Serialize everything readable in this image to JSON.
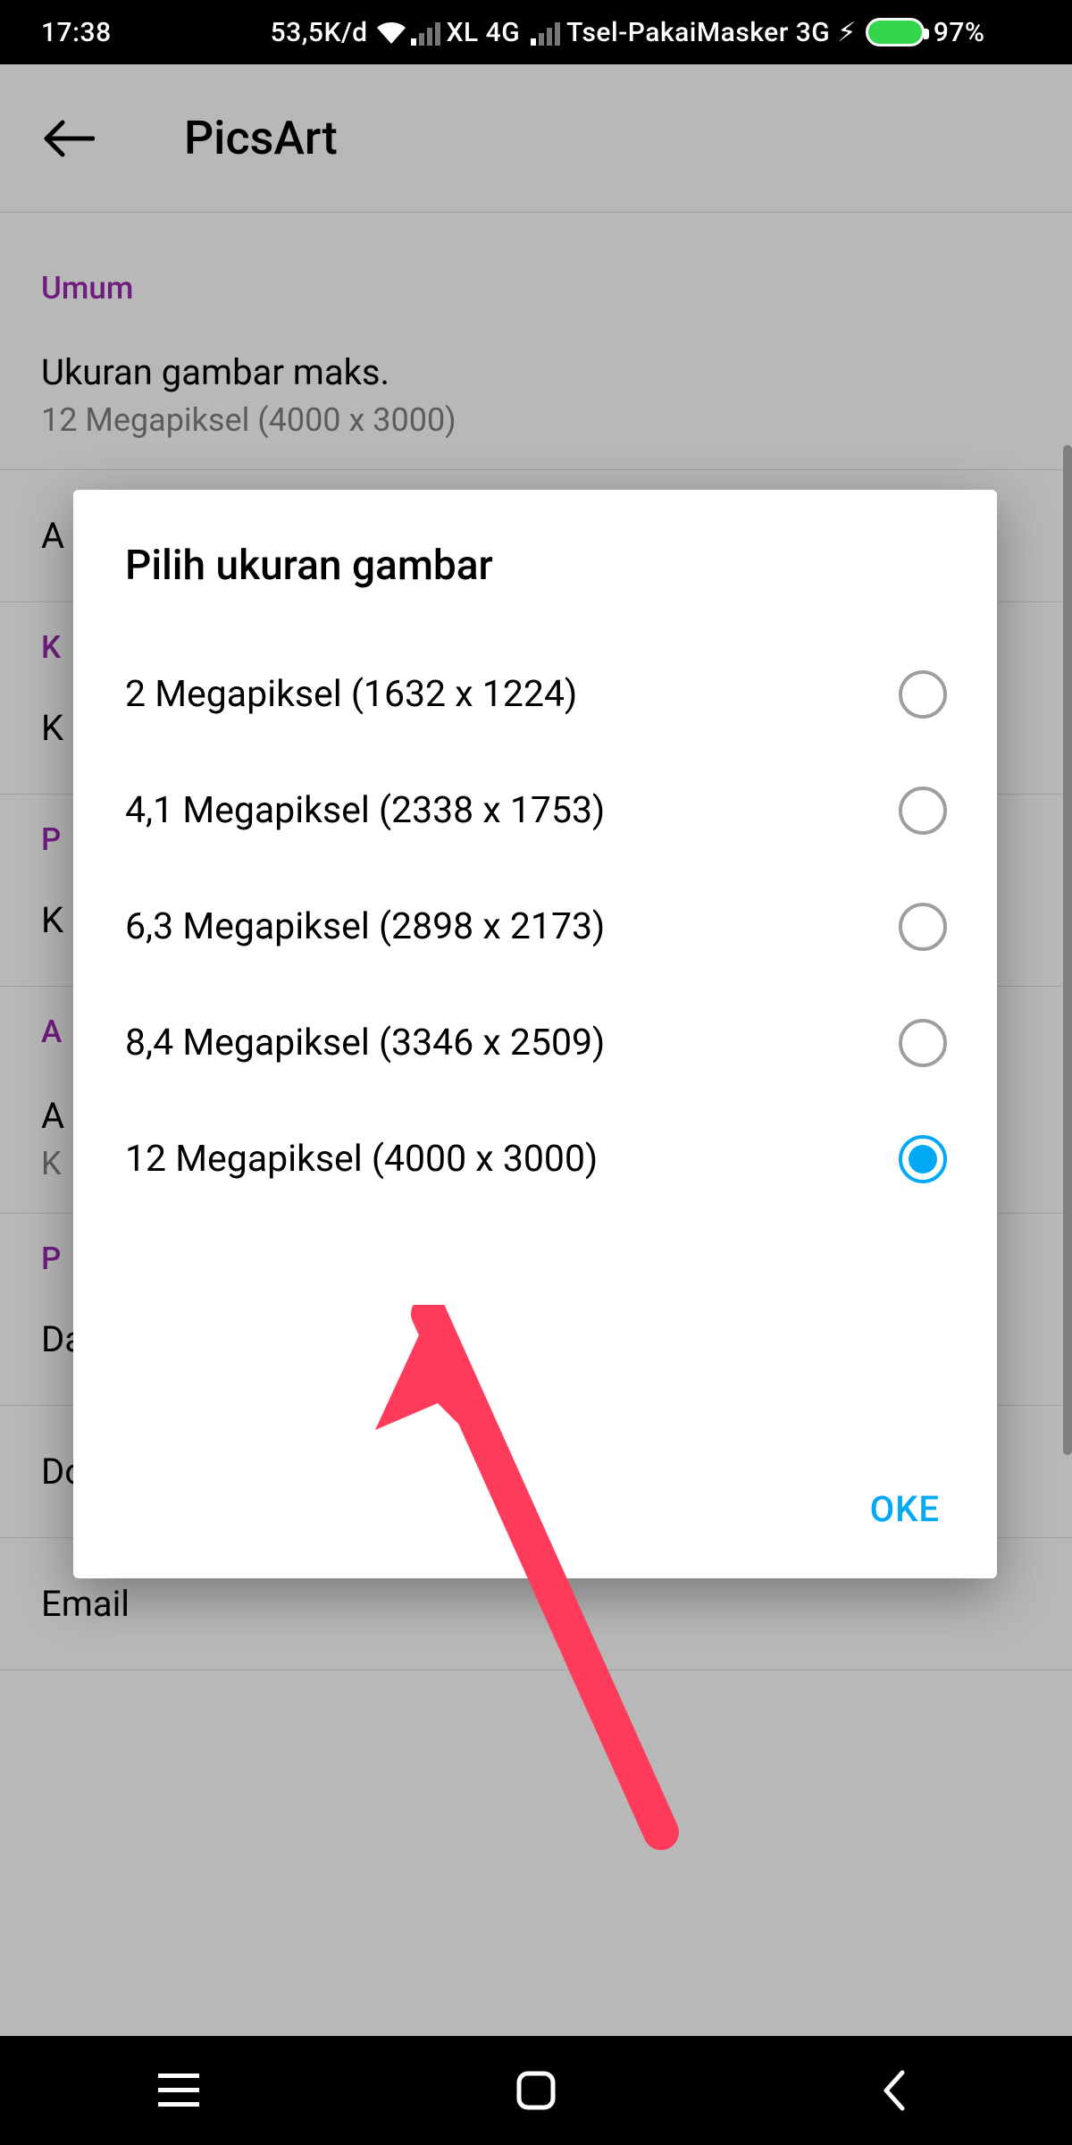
{
  "status_bar": {
    "time": "17:38",
    "data_rate": "53,5K/d",
    "carrier1": "XL 4G",
    "carrier2": "Tsel-PakaiMasker 3G",
    "battery_pct": "97%"
  },
  "app_bar": {
    "title": "PicsArt"
  },
  "sections": {
    "umum": {
      "header": "Umum",
      "max_size_title": "Ukuran gambar maks.",
      "max_size_value": "12 Megapiksel (4000 x 3000)",
      "a_trunc": "A",
      "k_header_trunc": "K",
      "k_item_trunc": "K",
      "p_header_trunc": "P",
      "k_item2_trunc": "K",
      "a_header_trunc": "A",
      "a_item_trunc": "A",
      "k_sub_trunc": "K",
      "p_header2_trunc": "P"
    },
    "list": {
      "dalam_app": "Dalam-Aplikasi",
      "dorong": "Dorong",
      "email": "Email"
    }
  },
  "dialog": {
    "title": "Pilih ukuran gambar",
    "options": [
      {
        "label": "2 Megapiksel (1632 x 1224)",
        "selected": false
      },
      {
        "label": "4,1 Megapiksel (2338 x 1753)",
        "selected": false
      },
      {
        "label": "6,3 Megapiksel (2898 x 2173)",
        "selected": false
      },
      {
        "label": "8,4 Megapiksel (3346 x 2509)",
        "selected": false
      },
      {
        "label": "12 Megapiksel (4000 x 3000)",
        "selected": true
      }
    ],
    "ok": "OKE"
  },
  "colors": {
    "accent": "#03a9f4",
    "section_header": "#9c27b0",
    "annotation_arrow": "#ff3b5c"
  }
}
